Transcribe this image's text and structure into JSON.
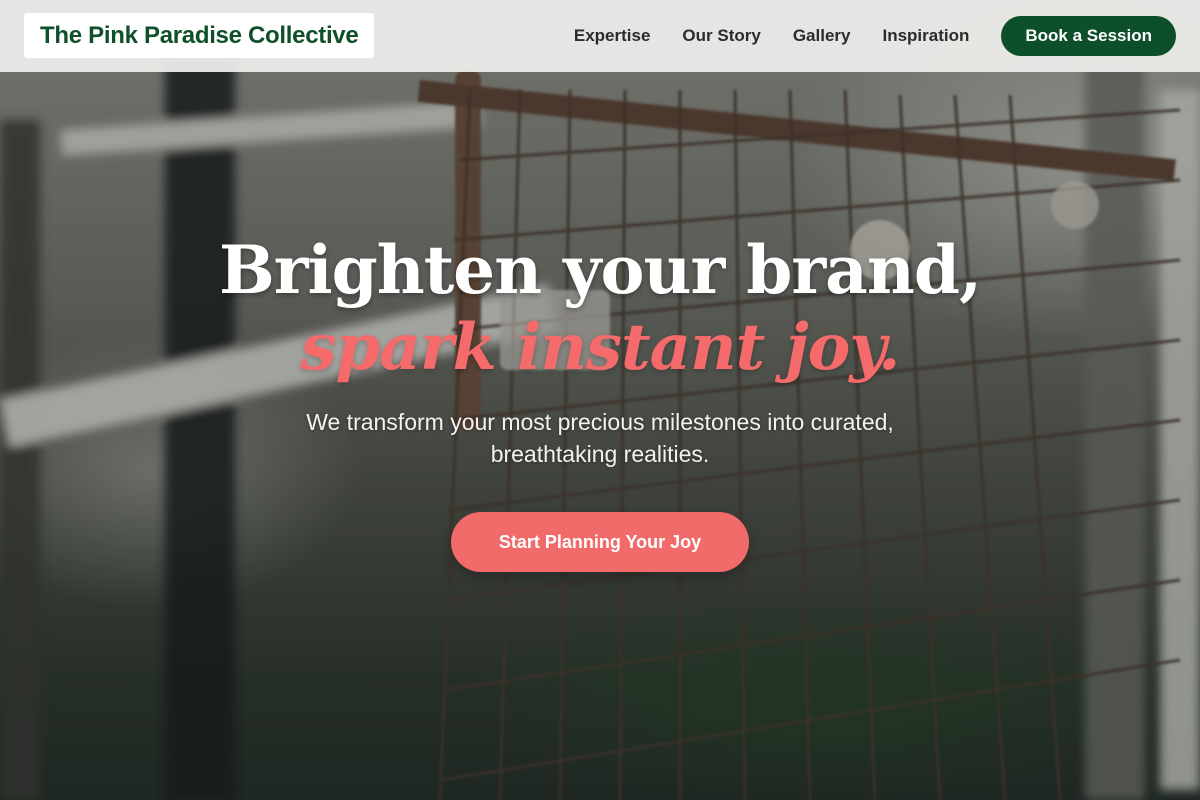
{
  "header": {
    "logo_text": "The Pink Paradise Collective",
    "nav": [
      {
        "label": "Expertise"
      },
      {
        "label": "Our Story"
      },
      {
        "label": "Gallery"
      },
      {
        "label": "Inspiration"
      }
    ],
    "cta_label": "Book a Session"
  },
  "hero": {
    "headline_line1": "Brighten your brand,",
    "headline_line2": "spark instant joy.",
    "subtitle": "We transform your most precious milestones into curated, breathtaking realities.",
    "cta_label": "Start Planning Your Joy"
  },
  "colors": {
    "brand_green": "#0d4f2b",
    "accent_coral": "#f26b6b",
    "header_bg": "#ececea"
  }
}
